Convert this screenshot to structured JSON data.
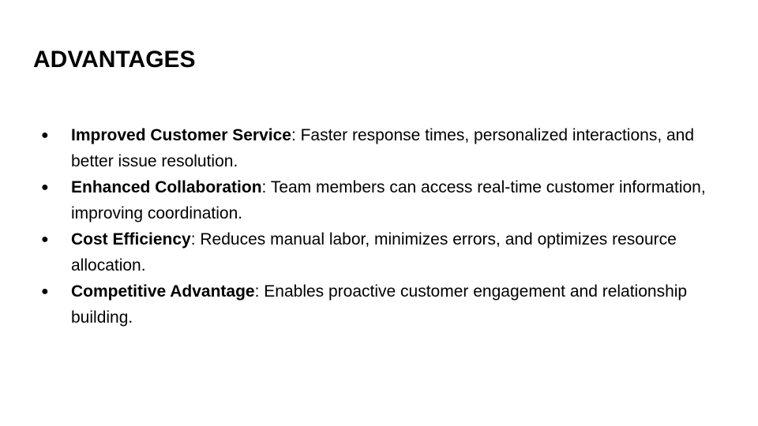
{
  "slide": {
    "title": "ADVANTAGES",
    "bullet_symbol": "●",
    "items": [
      {
        "term": "Improved Customer Service",
        "description": ": Faster response times, personalized interactions, and better issue resolution."
      },
      {
        "term": "Enhanced Collaboration",
        "description": ": Team members can access real-time customer information, improving coordination."
      },
      {
        "term": "Cost Efficiency",
        "description": ": Reduces manual labor, minimizes errors, and optimizes resource allocation."
      },
      {
        "term": "Competitive Advantage",
        "description": ": Enables proactive customer engagement and relationship building."
      }
    ]
  }
}
